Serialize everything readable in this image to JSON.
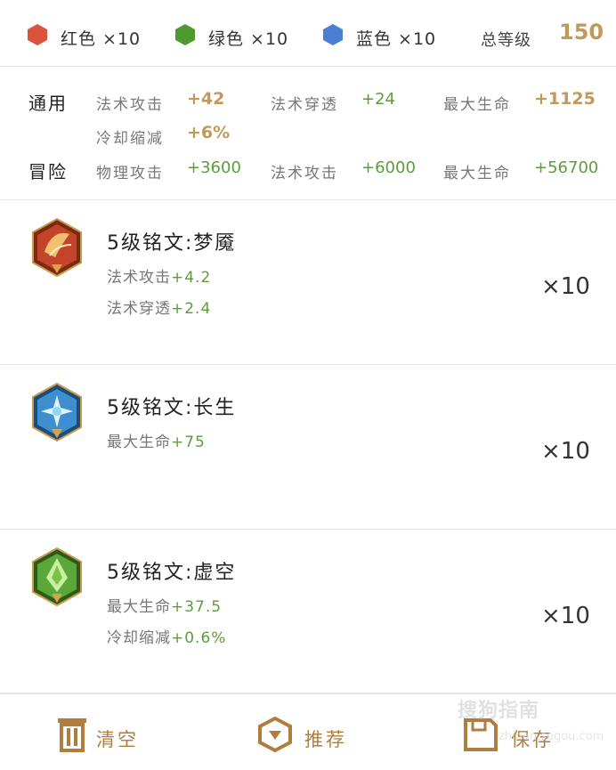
{
  "header": {
    "colors": [
      {
        "label": "红色 ×10",
        "color": "#d9533d",
        "icon": "red-gem-icon"
      },
      {
        "label": "绿色 ×10",
        "color": "#4f9a2f",
        "icon": "green-gem-icon"
      },
      {
        "label": "蓝色 ×10",
        "color": "#4a7fd4",
        "icon": "blue-gem-icon"
      }
    ],
    "level_label": "总等级",
    "level_value": "150"
  },
  "stats": {
    "general": {
      "label": "通用",
      "items": [
        {
          "name": "法术攻击",
          "value": "+42"
        },
        {
          "name": "法术穿透",
          "value": "+24"
        },
        {
          "name": "最大生命",
          "value": "+1125"
        },
        {
          "name": "冷却缩减",
          "value": "+6%"
        }
      ]
    },
    "adventure": {
      "label": "冒险",
      "items": [
        {
          "name": "物理攻击",
          "value": "+3600"
        },
        {
          "name": "法术攻击",
          "value": "+6000"
        },
        {
          "name": "最大生命",
          "value": "+56700"
        }
      ]
    }
  },
  "inscriptions": [
    {
      "name": "5级铭文:梦魇",
      "icon": "nightmare-inscription-icon",
      "lines": [
        {
          "name": "法术攻击",
          "value": "+4.2"
        },
        {
          "name": "法术穿透",
          "value": "+2.4"
        }
      ],
      "qty": "×10"
    },
    {
      "name": "5级铭文:长生",
      "icon": "longevity-inscription-icon",
      "lines": [
        {
          "name": "最大生命",
          "value": "+75"
        }
      ],
      "qty": "×10"
    },
    {
      "name": "5级铭文:虚空",
      "icon": "void-inscription-icon",
      "lines": [
        {
          "name": "最大生命",
          "value": "+37.5"
        },
        {
          "name": "冷却缩减",
          "value": "+0.6%"
        }
      ],
      "qty": "×10"
    }
  ],
  "footer": {
    "clear": "清空",
    "recommend": "推荐",
    "save": "保存"
  },
  "watermark": {
    "text": "搜狗指南",
    "url": "zhinan.sogou.com"
  },
  "accent_color": "#c19a5b"
}
